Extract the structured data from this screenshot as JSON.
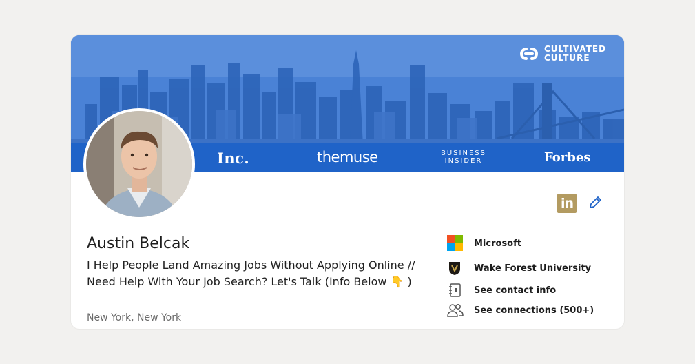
{
  "banner": {
    "brand_logo": "CULTIVATED\nCULTURE",
    "press_logos": {
      "inc": "Inc.",
      "themuse": "themuse",
      "business_insider": "BUSINESS\nINSIDER",
      "forbes": "Forbes"
    },
    "colors": {
      "sky": "#4a82d6",
      "strip": "#1f63c8"
    }
  },
  "profile": {
    "name": "Austin Belcak",
    "headline": "I Help People Land Amazing Jobs Without Applying Online // Need Help With Your Job Search? Let's Talk (Info Below 👇 )",
    "location": "New York, New York",
    "linkedin_badge": "in"
  },
  "sidebar": {
    "items": [
      {
        "label": "Microsoft",
        "icon": "microsoft-logo-icon"
      },
      {
        "label": "Wake Forest University",
        "icon": "wake-forest-logo-icon"
      },
      {
        "label": "See contact info",
        "icon": "contact-card-icon"
      },
      {
        "label": "See connections (500+)",
        "icon": "people-icon"
      }
    ]
  }
}
